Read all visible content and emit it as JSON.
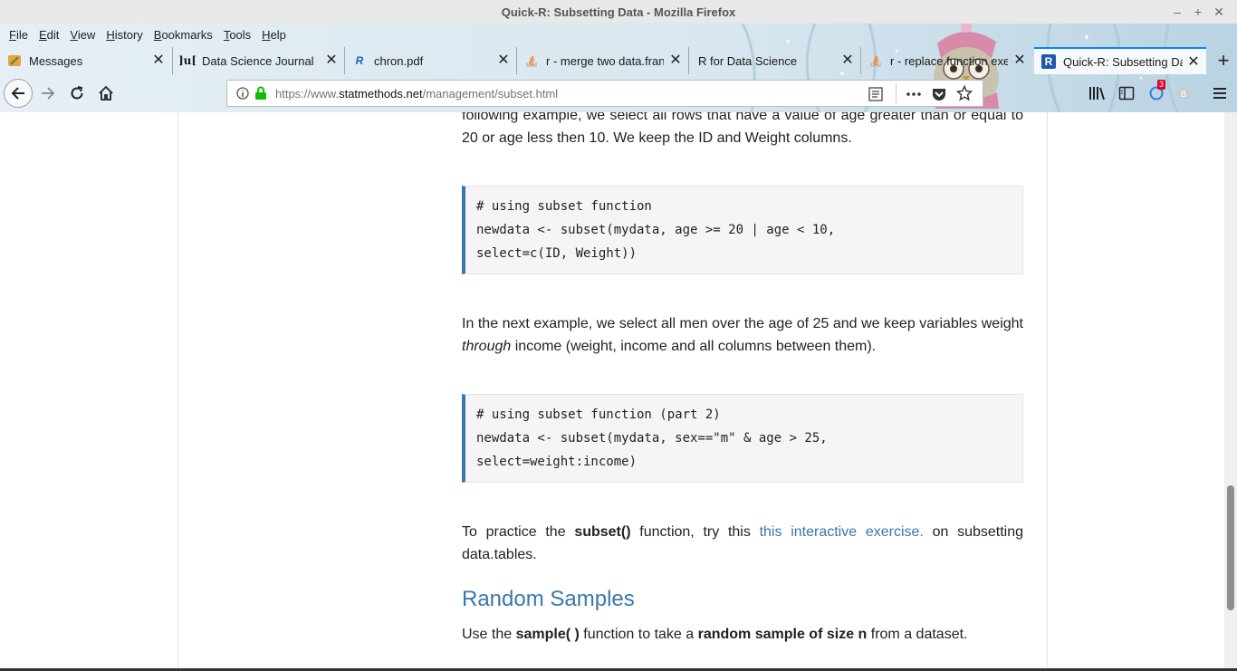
{
  "window": {
    "title": "Quick-R: Subsetting Data - Mozilla Firefox",
    "controls": [
      "–",
      "+",
      "✕"
    ]
  },
  "menubar": [
    {
      "label": "File",
      "u": "F",
      "rest": "ile"
    },
    {
      "label": "Edit",
      "u": "E",
      "rest": "dit"
    },
    {
      "label": "View",
      "u": "V",
      "rest": "iew"
    },
    {
      "label": "History",
      "u": "H",
      "rest": "istory"
    },
    {
      "label": "Bookmarks",
      "u": "B",
      "rest": "ookmarks"
    },
    {
      "label": "Tools",
      "u": "T",
      "rest": "ools"
    },
    {
      "label": "Help",
      "u": "H",
      "rest": "elp"
    }
  ],
  "tabs": [
    {
      "label": "Messages",
      "icon": "messages-icon",
      "active": false
    },
    {
      "label": "Data Science Journal",
      "icon": "journal-icon",
      "active": false
    },
    {
      "label": "chron.pdf",
      "icon": "r-logo-icon",
      "active": false
    },
    {
      "label": "r - merge two data.fran",
      "icon": "stackoverflow-icon",
      "active": false
    },
    {
      "label": "R for Data Science",
      "icon": "none",
      "active": false
    },
    {
      "label": "r - replace function exe",
      "icon": "stackoverflow-icon",
      "active": false
    },
    {
      "label": "Quick-R: Subsetting Da",
      "icon": "r-logo-icon",
      "active": true
    }
  ],
  "tab_icon_text": {
    "journal": "]u[",
    "r": "R"
  },
  "navbar": {
    "url_prefix": "https://www.",
    "url_host": "statmethods.net",
    "url_path": "/management/subset.html",
    "badge_count": "3"
  },
  "content": {
    "para1": "following example, we select all rows that have a value of age greater than or equal to 20 or age less then 10. We keep the ID and Weight columns.",
    "code1": [
      "# using subset function",
      "newdata <- subset(mydata, age >= 20 | age < 10,",
      "select=c(ID, Weight))"
    ],
    "para2_a": "In the next example, we select all men over the age of 25 and we keep variables weight ",
    "para2_em": "through",
    "para2_b": " income (weight, income and all columns between them).",
    "code2": [
      "# using subset function (part 2)",
      "newdata <- subset(mydata, sex==\"m\" & age > 25,",
      "select=weight:income)"
    ],
    "para3_a": "To practice the ",
    "para3_strong": "subset()",
    "para3_b": " function, try this ",
    "para3_link": "this interactive exercise.",
    "para3_c": " on subsetting data.tables.",
    "heading": "Random Samples",
    "para4_a": "Use the ",
    "para4_s1": "sample( )",
    "para4_b": " function to take a ",
    "para4_s2": "random sample of size n",
    "para4_c": " from a dataset."
  },
  "colors": {
    "accent": "#0a84ff",
    "link": "#3b77a8",
    "code_border": "#3b77a8"
  }
}
